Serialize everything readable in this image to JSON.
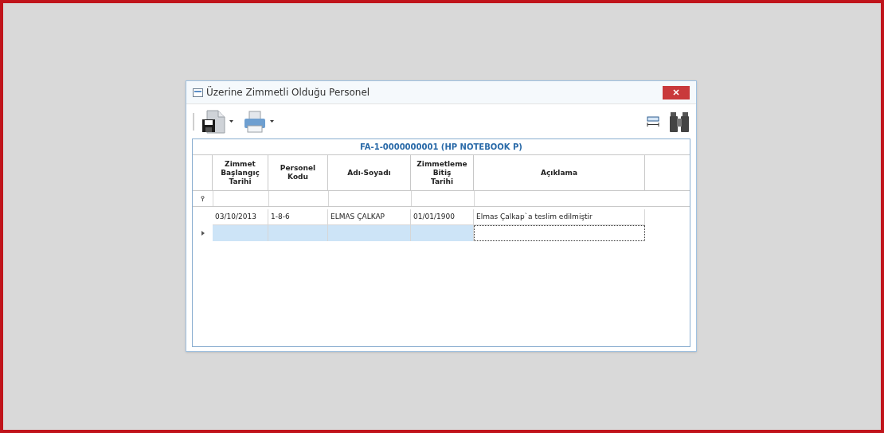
{
  "window": {
    "title": "Üzerine Zimmetli Olduğu Personel"
  },
  "toolbar": {
    "left": [
      {
        "kind": "save",
        "dropdown": true
      },
      {
        "kind": "print",
        "dropdown": true
      }
    ],
    "right": [
      {
        "kind": "fit"
      },
      {
        "kind": "find"
      }
    ]
  },
  "grid": {
    "title": "FA-1-0000000001 (HP NOTEBOOK P)",
    "columns": [
      "Zimmet\nBaşlangıç\nTarihi",
      "Personel\nKodu",
      "Adı-Soyadı",
      "Zimmetleme\nBitiş\nTarihi",
      "Açıklama"
    ],
    "rows": [
      {
        "kind": "data",
        "selected": false,
        "cells": [
          "03/10/2013",
          "1-8-6",
          "ELMAS ÇALKAP",
          "01/01/1900",
          "Elmas Çalkap`a teslim edilmiştir"
        ]
      },
      {
        "kind": "new",
        "selected": true
      }
    ]
  }
}
